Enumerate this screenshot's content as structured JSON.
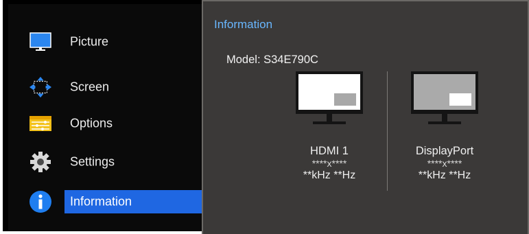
{
  "sidebar": {
    "items": [
      {
        "label": "Picture",
        "icon": "monitor-icon",
        "active": false
      },
      {
        "label": "Screen",
        "icon": "resize-arrows-icon",
        "active": false
      },
      {
        "label": "Options",
        "icon": "sliders-icon",
        "active": false
      },
      {
        "label": "Settings",
        "icon": "gear-icon",
        "active": false
      },
      {
        "label": "Information",
        "icon": "info-icon",
        "active": true
      }
    ]
  },
  "panel": {
    "title": "Information",
    "model": "Model: S34E790C",
    "displays": [
      {
        "name": "HDMI 1",
        "resolution": "****x****",
        "frequency": "**kHz **Hz",
        "screen_style": "white-with-gray-inset"
      },
      {
        "name": "DisplayPort",
        "resolution": "****x****",
        "frequency": "**kHz **Hz",
        "screen_style": "gray-with-white-inset"
      }
    ]
  },
  "colors": {
    "sidebar_bg": "#0a0a0a",
    "panel_bg": "#3b3938",
    "active_highlight": "#1f67e2",
    "title_accent": "#69b7ff"
  }
}
